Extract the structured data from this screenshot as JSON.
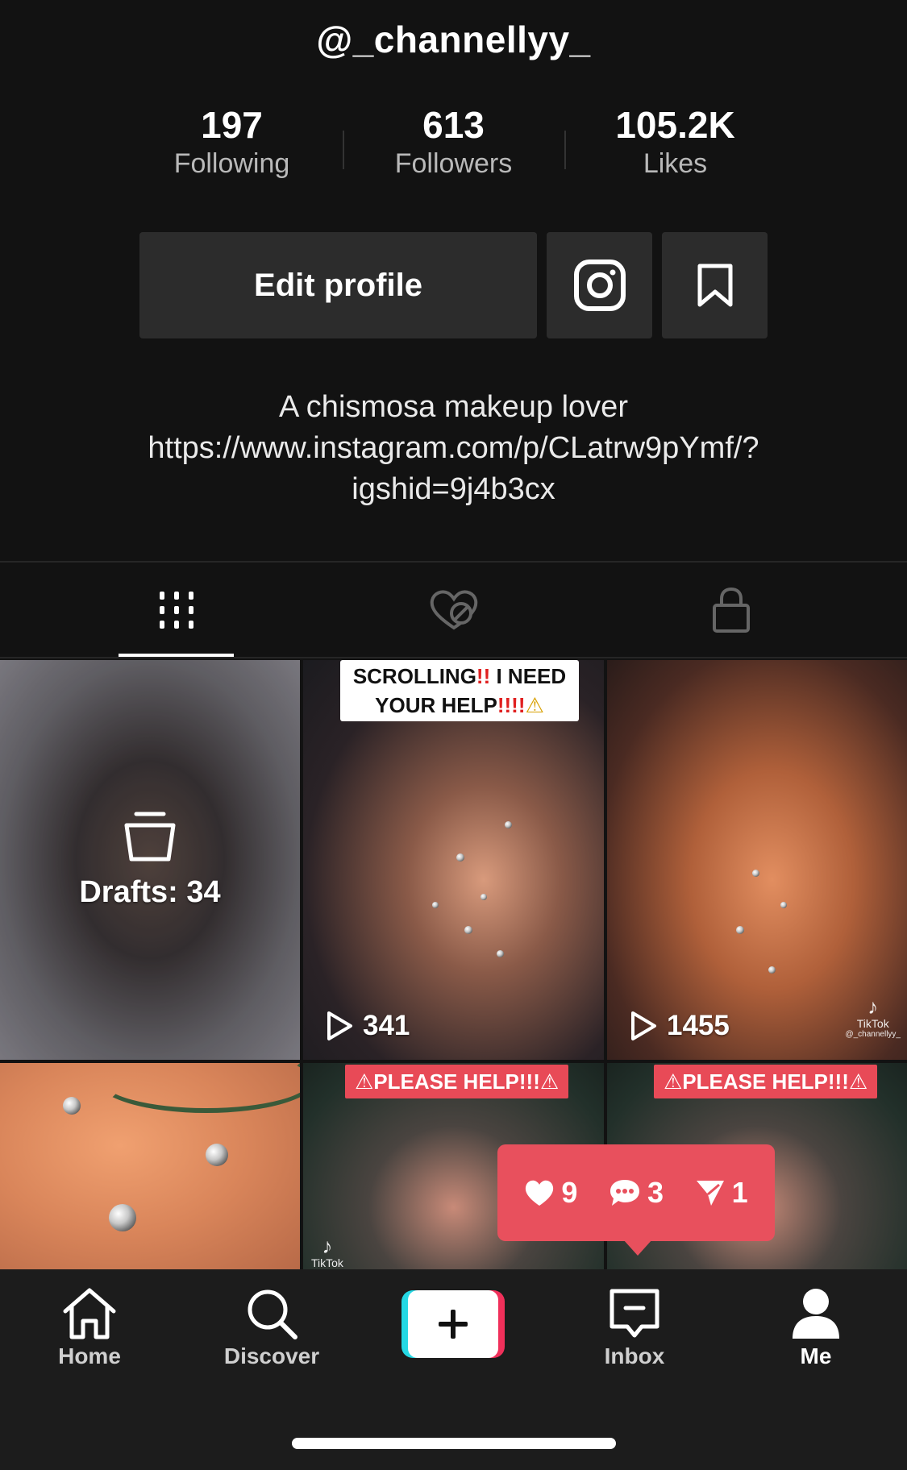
{
  "profile": {
    "username": "@_channellyy_",
    "stats": [
      {
        "value": "197",
        "label": "Following"
      },
      {
        "value": "613",
        "label": "Followers"
      },
      {
        "value": "105.2K",
        "label": "Likes"
      }
    ],
    "edit_label": "Edit profile",
    "bio_lines": [
      "A chismosa makeup lover",
      "https://www.instagram.com/p/CLatrw9pYmf/?",
      "igshid=9j4b3cx"
    ]
  },
  "tabs": [
    {
      "icon": "grid-icon",
      "active": true
    },
    {
      "icon": "hidden-likes-icon",
      "active": false
    },
    {
      "icon": "lock-icon",
      "active": false
    }
  ],
  "videos": {
    "drafts_label": "Drafts: 34",
    "items": [
      {
        "views": "341",
        "caption_a": "SCROLLING",
        "caption_b": "!!",
        "caption_c": " I NEED",
        "caption_d": "YOUR HELP",
        "caption_e": "!!!!",
        "caption_f": "⚠"
      },
      {
        "views": "1455",
        "watermark": "TikTok",
        "watermark_handle": "@_channellyy_"
      },
      {
        "caption": "⚠PLEASE HELP!!!⚠",
        "watermark": "TikTok"
      },
      {
        "caption": "⚠PLEASE HELP!!!⚠"
      }
    ]
  },
  "notification": {
    "likes": "9",
    "comments": "3",
    "shares": "1",
    "color": "#e8505d"
  },
  "nav": {
    "home": "Home",
    "discover": "Discover",
    "inbox": "Inbox",
    "me": "Me"
  }
}
